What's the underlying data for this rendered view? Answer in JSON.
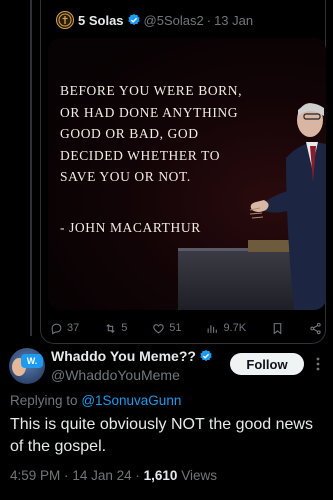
{
  "quoted_tweet": {
    "author_name": "5 Solas",
    "handle": "@5Solas2",
    "separator": "·",
    "date": "13 Jan",
    "image": {
      "quote_lines": [
        "Before you were born,",
        "or had done anything",
        "good or bad, God",
        "decided whether to",
        "save you or not."
      ],
      "attribution": "- John MacArthur"
    },
    "actions": {
      "replies": "37",
      "reposts": "5",
      "likes": "51",
      "views": "9.7K"
    }
  },
  "reply_tweet": {
    "author_name": "Whaddo You Meme??",
    "handle": "@WhaddoYouMeme",
    "avatar_badge": "W.",
    "follow_label": "Follow",
    "replying_prefix": "Replying to",
    "replying_to": "@1SonuvaGunn",
    "text": "This is quite obviously NOT the good news of the gospel.",
    "time": "4:59 PM",
    "date": "14 Jan 24",
    "views_count": "1,610",
    "views_label": "Views"
  },
  "colors": {
    "background": "#000000",
    "text_primary": "#e7e9ea",
    "text_secondary": "#71767b",
    "link": "#1d9bf0",
    "verified": "#1d9bf0",
    "follow_bg": "#eff3f4"
  }
}
